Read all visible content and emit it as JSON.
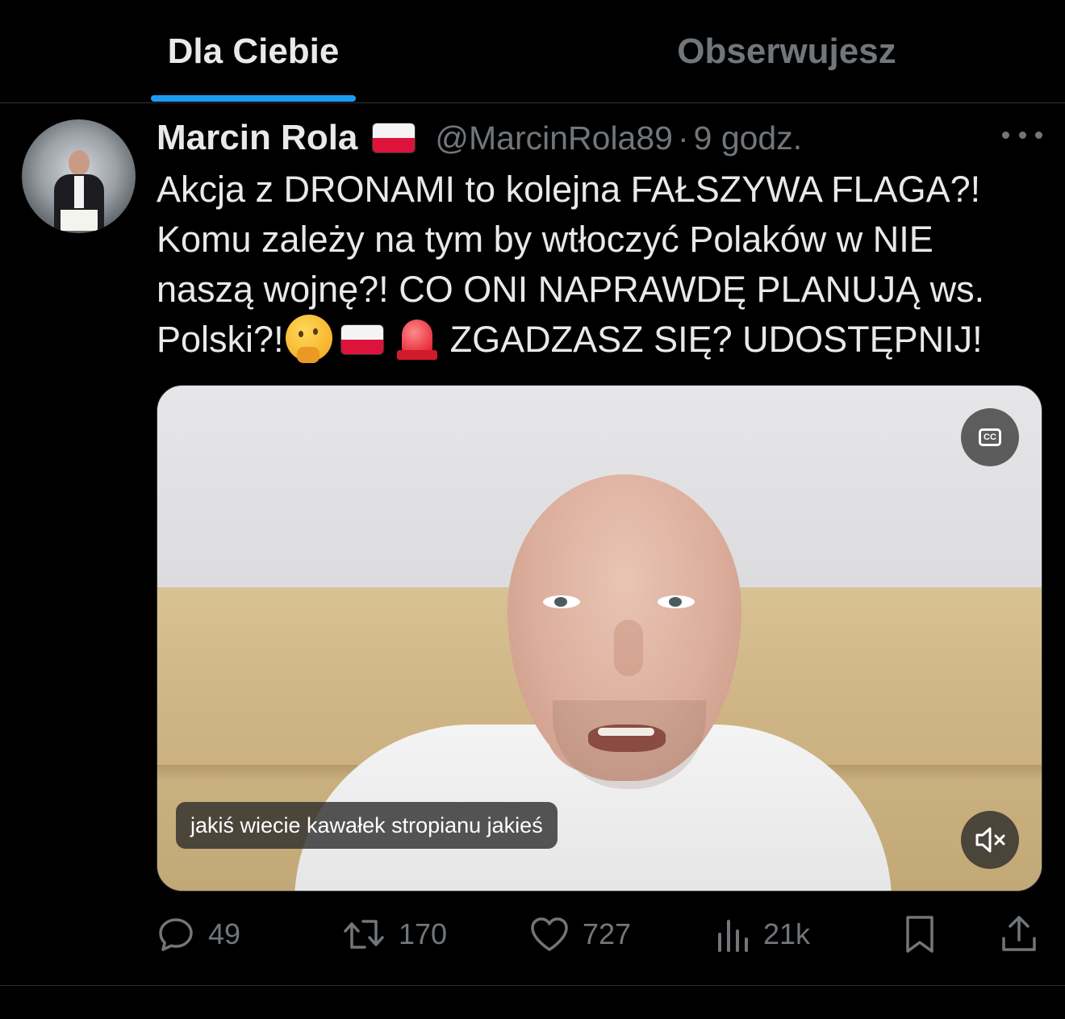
{
  "tabs": [
    {
      "label": "Dla Ciebie",
      "active": true
    },
    {
      "label": "Obserwujesz",
      "active": false
    }
  ],
  "colors": {
    "accent": "#1d9bf0",
    "muted": "#71767b",
    "text": "#e7e9ea",
    "background": "#000000"
  },
  "tweet": {
    "display_name": "Marcin Rola",
    "handle": "@MarcinRola89",
    "separator": "·",
    "time": "9 godz.",
    "text_part1": "Akcja z DRONAMI to kolejna FAŁSZYWA FLAGA?! Komu zależy na tym by wtłoczyć Polaków w NIE naszą wojnę?! CO ONI NAPRAWDĘ PLANUJĄ ws. Polski?!",
    "text_part2": "ZGADZASZ SIĘ? UDOSTĘPNIJ!",
    "emojis": [
      "thinking-face",
      "poland-flag",
      "police-light"
    ],
    "video": {
      "caption": "jakiś wiecie kawałek stropianu jakieś",
      "cc_label": "CC",
      "muted": true
    },
    "stats": {
      "replies": "49",
      "retweets": "170",
      "likes": "727",
      "views": "21k"
    }
  }
}
